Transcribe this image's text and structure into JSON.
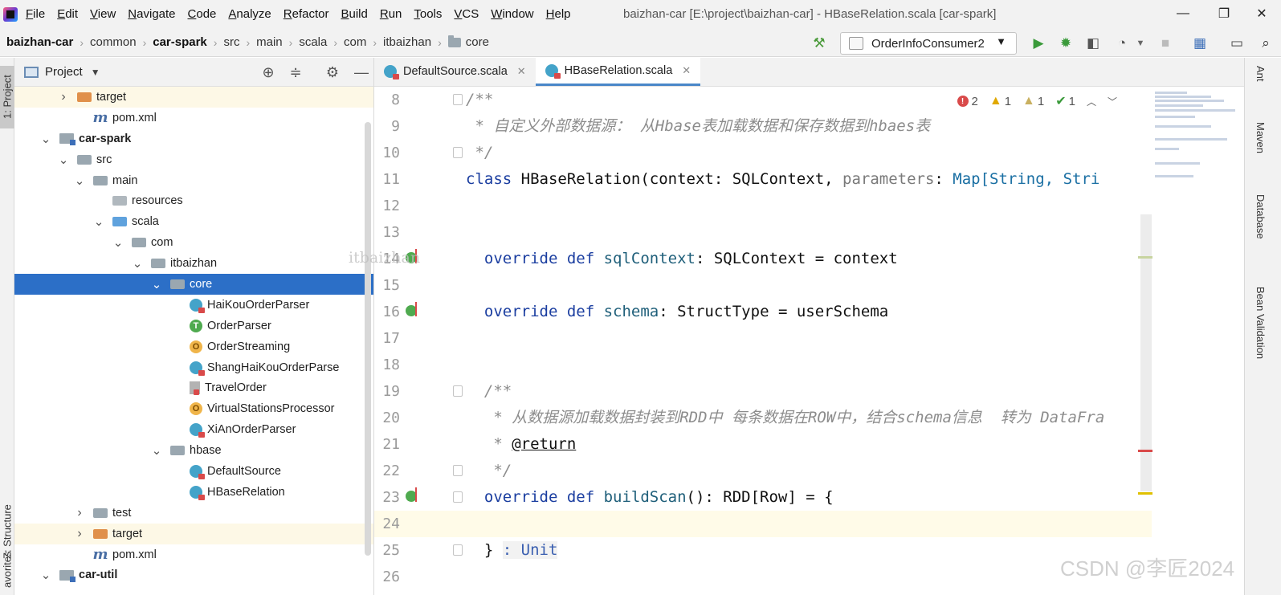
{
  "menu": {
    "items": [
      "File",
      "Edit",
      "View",
      "Navigate",
      "Code",
      "Analyze",
      "Refactor",
      "Build",
      "Run",
      "Tools",
      "VCS",
      "Window",
      "Help"
    ],
    "window_title": "baizhan-car [E:\\project\\baizhan-car] - HBaseRelation.scala [car-spark]"
  },
  "breadcrumb": [
    "baizhan-car",
    "common",
    "car-spark",
    "src",
    "main",
    "scala",
    "com",
    "itbaizhan",
    "core"
  ],
  "toolbar": {
    "run_config": "OrderInfoConsumer2",
    "icons": [
      "hammer-icon",
      "run-icon",
      "debug-icon",
      "coverage-icon",
      "profile-icon",
      "stop-icon",
      "project-structure-icon",
      "terminal-icon",
      "search-everywhere-icon"
    ]
  },
  "left_strip": {
    "tabs": [
      "1: Project",
      "Z: Structure",
      "avorites"
    ]
  },
  "project_panel": {
    "title": "Project",
    "tree": [
      {
        "label": "target",
        "icon": "folder-orange",
        "arrow": "collapsed",
        "tinted": true
      },
      {
        "label": "pom.xml",
        "icon": "maven",
        "arrow": "none",
        "tinted": false
      },
      {
        "label": "car-spark",
        "icon": "module",
        "arrow": "expanded",
        "bold": true
      },
      {
        "label": "src",
        "icon": "folder-gray",
        "arrow": "expanded"
      },
      {
        "label": "main",
        "icon": "folder-gray",
        "arrow": "expanded"
      },
      {
        "label": "resources",
        "icon": "folder-res",
        "arrow": "none"
      },
      {
        "label": "scala",
        "icon": "folder-blue",
        "arrow": "expanded"
      },
      {
        "label": "com",
        "icon": "folder-gray",
        "arrow": "expanded"
      },
      {
        "label": "itbaizhan",
        "icon": "folder-gray",
        "arrow": "expanded"
      },
      {
        "label": "core",
        "icon": "folder-gray",
        "arrow": "expanded",
        "selected": true
      },
      {
        "label": "HaiKouOrderParser",
        "icon": "cls-c",
        "arrow": "none"
      },
      {
        "label": "OrderParser",
        "icon": "cls-t",
        "arrow": "none"
      },
      {
        "label": "OrderStreaming",
        "icon": "cls-o",
        "arrow": "none"
      },
      {
        "label": "ShangHaiKouOrderParse",
        "icon": "cls-c",
        "arrow": "none"
      },
      {
        "label": "TravelOrder",
        "icon": "file-gray",
        "arrow": "none"
      },
      {
        "label": "VirtualStatio",
        "icon": "cls-o",
        "arrow": "none"
      },
      {
        "label": "XiAnOrderParser",
        "icon": "cls-c",
        "arrow": "none"
      },
      {
        "label": "hbase",
        "icon": "folder-gray",
        "arrow": "expanded"
      },
      {
        "label": "DefaultSource",
        "icon": "cls-c",
        "arrow": "none"
      },
      {
        "label": "HBaseRelation",
        "icon": "cls-c",
        "arrow": "none"
      },
      {
        "label": "test",
        "icon": "folder-gray",
        "arrow": "collapsed"
      },
      {
        "label": "target",
        "icon": "folder-orange",
        "arrow": "collapsed",
        "tinted": true
      },
      {
        "label": "pom.xml",
        "icon": "maven",
        "arrow": "none"
      },
      {
        "label": "car-util",
        "icon": "module",
        "arrow": "expanded",
        "bold": true
      }
    ],
    "tree_extra": {
      "virtual_suffix": "nsProcessor"
    }
  },
  "editor": {
    "tabs": [
      {
        "label": "DefaultSource.scala",
        "active": false
      },
      {
        "label": "HBaseRelation.scala",
        "active": true
      }
    ],
    "inspection": {
      "errors": "2",
      "warnings": "1",
      "weak_warnings": "1",
      "typos": "1"
    },
    "lines": [
      {
        "n": "8",
        "fold": true,
        "parts": [
          {
            "t": "/**",
            "c": "cm"
          }
        ]
      },
      {
        "n": "9",
        "parts": [
          {
            "t": " * 自定义外部数据源： 从Hbase表加载数据和保存数据到hbaes表",
            "c": "cm"
          }
        ]
      },
      {
        "n": "10",
        "fold": true,
        "parts": [
          {
            "t": " */",
            "c": "cm"
          }
        ]
      },
      {
        "n": "11",
        "parts": [
          {
            "t": "class ",
            "c": "kw"
          },
          {
            "t": "HBaseRelation(context: SQLContext, ",
            "c": ""
          },
          {
            "t": "parameters",
            "c": "pr"
          },
          {
            "t": ": ",
            "c": ""
          },
          {
            "t": "Map[String, Stri",
            "c": "ty"
          }
        ]
      },
      {
        "n": "12",
        "parts": []
      },
      {
        "n": "13",
        "parts": []
      },
      {
        "n": "14",
        "gicon": true,
        "parts": [
          {
            "t": "  override def ",
            "c": "kw"
          },
          {
            "t": "sqlContext",
            "c": "fn"
          },
          {
            "t": ": SQLContext = context",
            "c": ""
          }
        ]
      },
      {
        "n": "15",
        "parts": []
      },
      {
        "n": "16",
        "gicon": true,
        "parts": [
          {
            "t": "  override def ",
            "c": "kw"
          },
          {
            "t": "schema",
            "c": "fn"
          },
          {
            "t": ": StructType = userSchema",
            "c": ""
          }
        ]
      },
      {
        "n": "17",
        "parts": []
      },
      {
        "n": "18",
        "parts": []
      },
      {
        "n": "19",
        "fold": true,
        "parts": [
          {
            "t": "  /**",
            "c": "cm"
          }
        ]
      },
      {
        "n": "20",
        "parts": [
          {
            "t": "   * 从数据源加载数据封装到RDD中 每条数据在ROW中，结合schema信息  转为 DataFra",
            "c": "cm"
          }
        ]
      },
      {
        "n": "21",
        "parts": [
          {
            "t": "   * ",
            "c": "cm"
          },
          {
            "t": "@return",
            "c": "tag"
          }
        ]
      },
      {
        "n": "22",
        "fold": true,
        "parts": [
          {
            "t": "   */",
            "c": "cm"
          }
        ]
      },
      {
        "n": "23",
        "gicon": true,
        "fold": true,
        "parts": [
          {
            "t": "  override def ",
            "c": "kw"
          },
          {
            "t": "buildScan",
            "c": "fn"
          },
          {
            "t": "(): RDD[Row] = {",
            "c": ""
          }
        ]
      },
      {
        "n": "24",
        "current": true,
        "parts": []
      },
      {
        "n": "25",
        "fold": true,
        "parts": [
          {
            "t": "  } ",
            "c": ""
          },
          {
            "t": ": Unit",
            "c": "hint"
          }
        ]
      },
      {
        "n": "26",
        "parts": []
      }
    ]
  },
  "right_strip": {
    "tabs": [
      "Ant",
      "Maven",
      "Database",
      "Bean Validation"
    ]
  },
  "watermarks": {
    "center": "itbaizhan",
    "corner": "CSDN @李匠2024"
  },
  "colors": {
    "selection": "#2c6fc7",
    "keyword": "#1b3ea0",
    "comment": "#8c8c8c",
    "error": "#d94a4a"
  }
}
